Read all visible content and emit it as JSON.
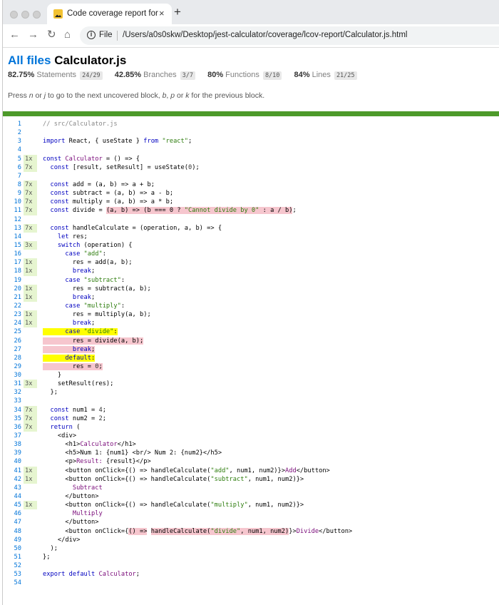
{
  "browser": {
    "tab_title": "Code coverage report for Cal",
    "tab_close": "×",
    "new_tab": "+",
    "nav": {
      "back": "←",
      "forward": "→",
      "reload": "↻",
      "home": "⌂"
    },
    "url_scheme": "File",
    "url_path": "/Users/a0s0skw/Desktop/jest-calculator/coverage/lcov-report/Calculator.js.html"
  },
  "report": {
    "breadcrumb_link": "All files",
    "file_name": "Calculator.js",
    "stats": [
      {
        "pct": "82.75%",
        "label": "Statements",
        "fraction": "24/29"
      },
      {
        "pct": "42.85%",
        "label": "Branches",
        "fraction": "3/7"
      },
      {
        "pct": "80%",
        "label": "Functions",
        "fraction": "8/10"
      },
      {
        "pct": "84%",
        "label": "Lines",
        "fraction": "21/25"
      }
    ],
    "hint": "Press n or j to go to the next uncovered block, b, p or k for the previous block.",
    "status_color": "#4d9a2a"
  },
  "code": {
    "lines": [
      {
        "n": "1",
        "c": "",
        "s": "neutral",
        "h": "<span class=\"c\">// src/Calculator.js</span>"
      },
      {
        "n": "2",
        "c": "",
        "s": "neutral",
        "h": ""
      },
      {
        "n": "3",
        "c": "",
        "s": "neutral",
        "h": "<span class=\"k\">import</span> React, { useState } <span class=\"k\">from</span> <span class=\"s\">\"react\"</span>;"
      },
      {
        "n": "4",
        "c": "",
        "s": "neutral",
        "h": ""
      },
      {
        "n": "5",
        "c": "1x",
        "s": "yes",
        "h": "<span class=\"k\">const</span> <span class=\"t\">Calculator</span> = () =&gt; {"
      },
      {
        "n": "6",
        "c": "7x",
        "s": "yes",
        "h": "  <span class=\"k\">const</span> [result, setResult] = useState(<span class=\"n\">0</span>);"
      },
      {
        "n": "7",
        "c": "",
        "s": "neutral",
        "h": ""
      },
      {
        "n": "8",
        "c": "7x",
        "s": "yes",
        "h": "  <span class=\"k\">const</span> add = (a, b) =&gt; a + b;"
      },
      {
        "n": "9",
        "c": "7x",
        "s": "yes",
        "h": "  <span class=\"k\">const</span> subtract = (a, b) =&gt; a - b;"
      },
      {
        "n": "10",
        "c": "7x",
        "s": "yes",
        "h": "  <span class=\"k\">const</span> multiply = (a, b) =&gt; a * b;"
      },
      {
        "n": "11",
        "c": "7x",
        "s": "yes",
        "h": "  <span class=\"k\">const</span> divide = <span class=\"hl\">(a, b) =&gt; (b === 0 ? <span class=\"s\">\"Cannot divide by 0\"</span> : a / b)</span>;"
      },
      {
        "n": "12",
        "c": "",
        "s": "neutral",
        "h": ""
      },
      {
        "n": "13",
        "c": "7x",
        "s": "yes",
        "h": "  <span class=\"k\">const</span> handleCalculate = (operation, a, b) =&gt; {"
      },
      {
        "n": "14",
        "c": "",
        "s": "neutral",
        "h": "    <span class=\"k\">let</span> res;"
      },
      {
        "n": "15",
        "c": "3x",
        "s": "yes",
        "h": "    <span class=\"k\">switch</span> (operation) {"
      },
      {
        "n": "16",
        "c": "",
        "s": "neutral",
        "h": "      <span class=\"k\">case</span> <span class=\"s\">\"add\"</span>:"
      },
      {
        "n": "17",
        "c": "1x",
        "s": "yes",
        "h": "        res = add(a, b);"
      },
      {
        "n": "18",
        "c": "1x",
        "s": "yes",
        "h": "        <span class=\"k\">break</span>;"
      },
      {
        "n": "19",
        "c": "",
        "s": "neutral",
        "h": "      <span class=\"k\">case</span> <span class=\"s\">\"subtract\"</span>:"
      },
      {
        "n": "20",
        "c": "1x",
        "s": "yes",
        "h": "        res = subtract(a, b);"
      },
      {
        "n": "21",
        "c": "1x",
        "s": "yes",
        "h": "        <span class=\"k\">break</span>;"
      },
      {
        "n": "22",
        "c": "",
        "s": "neutral",
        "h": "      <span class=\"k\">case</span> <span class=\"s\">\"multiply\"</span>:"
      },
      {
        "n": "23",
        "c": "1x",
        "s": "yes",
        "h": "        res = multiply(a, b);"
      },
      {
        "n": "24",
        "c": "1x",
        "s": "yes",
        "h": "        <span class=\"k\">break</span>;"
      },
      {
        "n": "25",
        "c": "",
        "s": "neutral",
        "h": "<span class=\"br\">      <span class=\"k\">case</span> <span class=\"s\">\"divide\"</span>:</span>"
      },
      {
        "n": "26",
        "c": "",
        "s": "no",
        "h": "<span class=\"hl\">        res = divide(a, b);</span>"
      },
      {
        "n": "27",
        "c": "",
        "s": "no",
        "h": "<span class=\"hl\">        <span class=\"k\">break</span>;</span>"
      },
      {
        "n": "28",
        "c": "",
        "s": "neutral",
        "h": "<span class=\"br\">      <span class=\"k\">default</span>:</span>"
      },
      {
        "n": "29",
        "c": "",
        "s": "no",
        "h": "<span class=\"hl\">        res = <span class=\"n\">0</span>;</span>"
      },
      {
        "n": "30",
        "c": "",
        "s": "neutral",
        "h": "    }"
      },
      {
        "n": "31",
        "c": "3x",
        "s": "yes",
        "h": "    setResult(res);"
      },
      {
        "n": "32",
        "c": "",
        "s": "neutral",
        "h": "  };"
      },
      {
        "n": "33",
        "c": "",
        "s": "neutral",
        "h": ""
      },
      {
        "n": "34",
        "c": "7x",
        "s": "yes",
        "h": "  <span class=\"k\">const</span> num1 = <span class=\"n\">4</span>;"
      },
      {
        "n": "35",
        "c": "7x",
        "s": "yes",
        "h": "  <span class=\"k\">const</span> num2 = <span class=\"n\">2</span>;"
      },
      {
        "n": "36",
        "c": "7x",
        "s": "yes",
        "h": "  <span class=\"k\">return</span> ("
      },
      {
        "n": "37",
        "c": "",
        "s": "neutral",
        "h": "    &lt;div&gt;"
      },
      {
        "n": "38",
        "c": "",
        "s": "neutral",
        "h": "      &lt;h1&gt;<span class=\"t\">Calculator</span>&lt;/h1&gt;"
      },
      {
        "n": "39",
        "c": "",
        "s": "neutral",
        "h": "      &lt;h5&gt;Num 1: {num1} &lt;br/&gt; Num 2: {num2}&lt;/h5&gt;"
      },
      {
        "n": "40",
        "c": "",
        "s": "neutral",
        "h": "      &lt;p&gt;<span class=\"t\">Result:</span> {result}&lt;/p&gt;"
      },
      {
        "n": "41",
        "c": "1x",
        "s": "yes",
        "h": "      &lt;button onClick={() =&gt; handleCalculate(<span class=\"s\">\"add\"</span>, num1, num2)}&gt;<span class=\"t\">Add</span>&lt;/button&gt;"
      },
      {
        "n": "42",
        "c": "1x",
        "s": "yes",
        "h": "      &lt;button onClick={() =&gt; handleCalculate(<span class=\"s\">\"subtract\"</span>, num1, num2)}&gt;"
      },
      {
        "n": "43",
        "c": "",
        "s": "neutral",
        "h": "        <span class=\"t\">Subtract</span>"
      },
      {
        "n": "44",
        "c": "",
        "s": "neutral",
        "h": "      &lt;/button&gt;"
      },
      {
        "n": "45",
        "c": "1x",
        "s": "yes",
        "h": "      &lt;button onClick={() =&gt; handleCalculate(<span class=\"s\">\"multiply\"</span>, num1, num2)}&gt;"
      },
      {
        "n": "46",
        "c": "",
        "s": "neutral",
        "h": "        <span class=\"t\">Multiply</span>"
      },
      {
        "n": "47",
        "c": "",
        "s": "neutral",
        "h": "      &lt;/button&gt;"
      },
      {
        "n": "48",
        "c": "",
        "s": "no",
        "h": "      &lt;button onClick={<span class=\"hl\">() =&gt;</span> <span class=\"hl\">handleCalculate(<span class=\"s\">\"divide\"</span>, num1, num2)</span>}&gt;<span class=\"t\">Divide</span>&lt;/button&gt;"
      },
      {
        "n": "49",
        "c": "",
        "s": "neutral",
        "h": "    &lt;/div&gt;"
      },
      {
        "n": "50",
        "c": "",
        "s": "neutral",
        "h": "  );"
      },
      {
        "n": "51",
        "c": "",
        "s": "neutral",
        "h": "};"
      },
      {
        "n": "52",
        "c": "",
        "s": "neutral",
        "h": ""
      },
      {
        "n": "53",
        "c": "",
        "s": "neutral",
        "h": "<span class=\"k\">export</span> <span class=\"k\">default</span> <span class=\"t\">Calculator</span>;"
      },
      {
        "n": "54",
        "c": "",
        "s": "neutral",
        "h": ""
      }
    ]
  }
}
